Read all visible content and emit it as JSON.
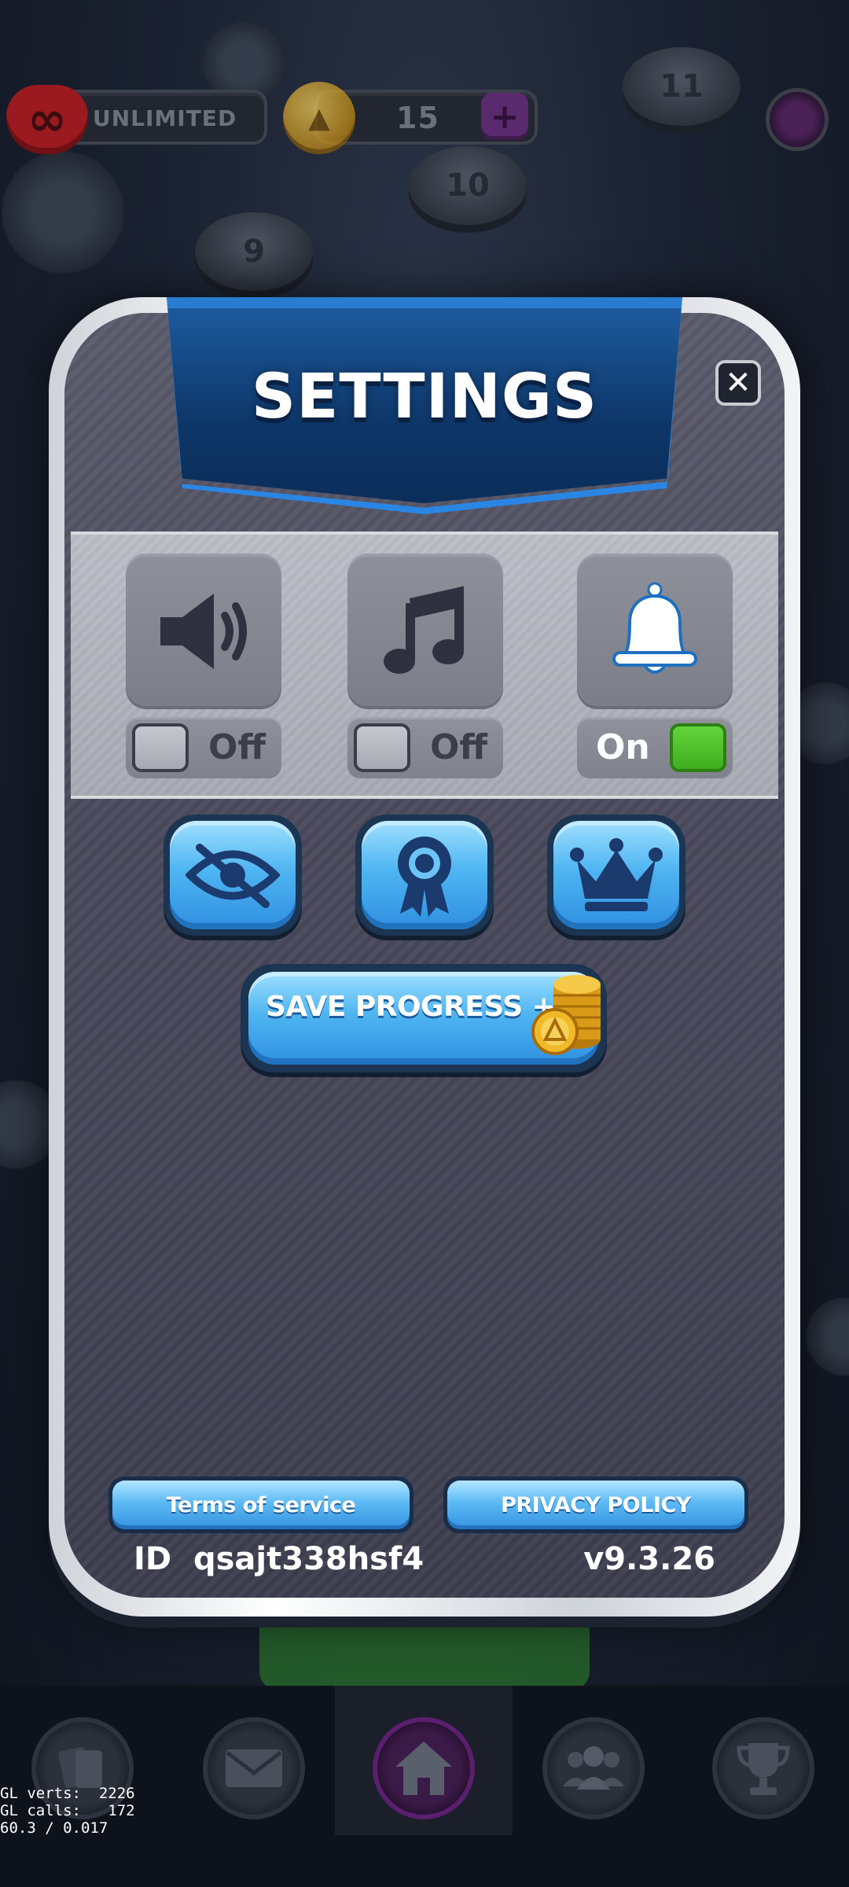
{
  "hud": {
    "lives_label": "UNLIMITED",
    "coins": "15",
    "plus_icon": "plus-icon"
  },
  "map": {
    "levels": [
      "9",
      "10",
      "11"
    ]
  },
  "settings": {
    "title": "SETTINGS",
    "close_icon": "close-icon",
    "toggles": [
      {
        "name": "sound",
        "icon": "speaker-icon",
        "state_label": "Off",
        "on": false
      },
      {
        "name": "music",
        "icon": "music-note-icon",
        "state_label": "Off",
        "on": false
      },
      {
        "name": "notifications",
        "icon": "bell-icon",
        "state_label": "On",
        "on": true
      }
    ],
    "icon_buttons": [
      {
        "name": "privacy",
        "icon": "eye-slash-icon"
      },
      {
        "name": "achievements",
        "icon": "ribbon-badge-icon"
      },
      {
        "name": "vip",
        "icon": "crown-icon"
      }
    ],
    "save_progress_label": "SAVE PROGRESS +",
    "terms_label": "Terms of service",
    "privacy_label": "PRIVACY POLICY",
    "player_id": "ID  qsajt338hsf4",
    "version": "v9.3.26"
  },
  "bottom_nav": [
    {
      "name": "cards",
      "icon": "cards-icon"
    },
    {
      "name": "mail",
      "icon": "envelope-icon"
    },
    {
      "name": "home",
      "icon": "home-icon",
      "active": true
    },
    {
      "name": "friends",
      "icon": "people-icon"
    },
    {
      "name": "leaderboard",
      "icon": "trophy-icon"
    }
  ],
  "debug": {
    "gl_stats": "GL verts:  2226\nGL calls:   172\n60.3 / 0.017"
  },
  "colors": {
    "accent_blue": "#4fb5f2",
    "toggle_on": "#4cc22a",
    "banner": "#0e3668"
  }
}
